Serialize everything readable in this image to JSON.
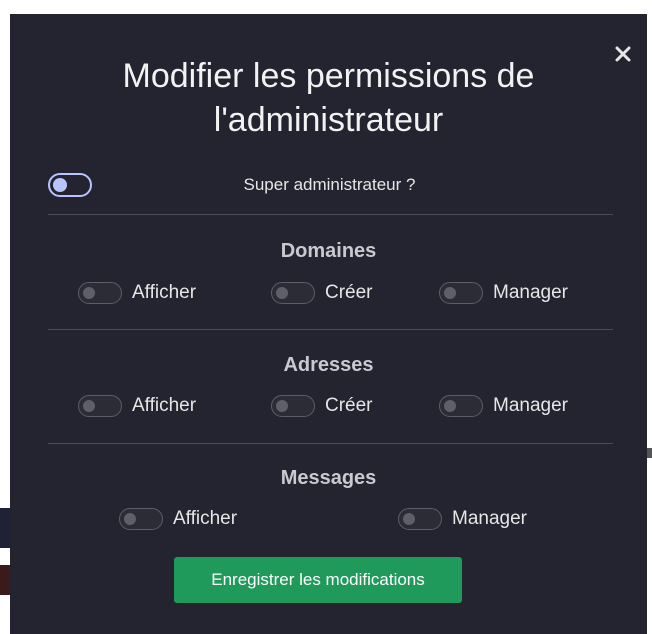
{
  "modal": {
    "title": "Modifier les permissions de l'administrateur",
    "close_label": "×",
    "super_admin": {
      "label": "Super administrateur ?",
      "enabled": false
    },
    "sections": [
      {
        "title": "Domaines",
        "permissions": [
          {
            "label": "Afficher",
            "enabled": false
          },
          {
            "label": "Créer",
            "enabled": false
          },
          {
            "label": "Manager",
            "enabled": false
          }
        ]
      },
      {
        "title": "Adresses",
        "permissions": [
          {
            "label": "Afficher",
            "enabled": false
          },
          {
            "label": "Créer",
            "enabled": false
          },
          {
            "label": "Manager",
            "enabled": false
          }
        ]
      },
      {
        "title": "Messages",
        "permissions": [
          {
            "label": "Afficher",
            "enabled": false
          },
          {
            "label": "Manager",
            "enabled": false
          }
        ]
      }
    ],
    "save_label": "Enregistrer les modifications"
  },
  "colors": {
    "modal_bg": "#232430",
    "accent_toggle": "#b9c3ff",
    "save_button": "#1f9a5a",
    "divider": "#4a4b57"
  }
}
